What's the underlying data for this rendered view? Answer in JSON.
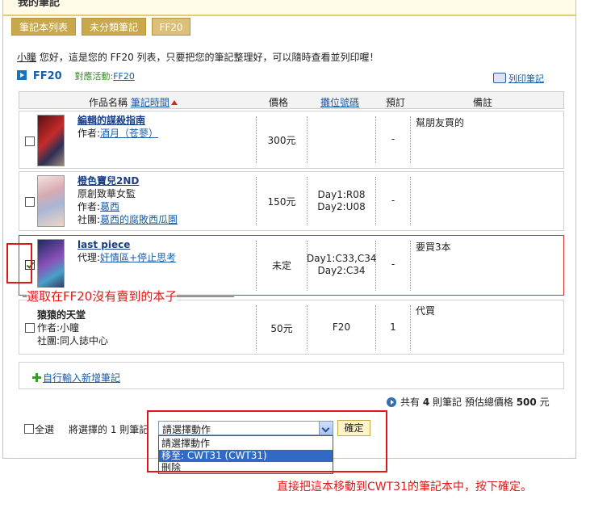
{
  "page": {
    "heading": "我的筆記"
  },
  "tabs": [
    {
      "label": "筆記本列表"
    },
    {
      "label": "未分類筆記"
    },
    {
      "label": "FF20"
    }
  ],
  "greeting": {
    "user": "小瞳",
    "text": " 您好，這是您的 FF20 列表，只要把您的筆記整理好，可以隨時查看並列印喔！"
  },
  "list": {
    "name": "FF20",
    "event_label": "對應活動:",
    "event_link": "FF20",
    "print_label": "列印筆記"
  },
  "table": {
    "headers": {
      "title": "作品名稱",
      "sort_time": "筆記時間",
      "price": "價格",
      "booth": "攤位號碼",
      "reserve": "預訂",
      "remark": "備註"
    },
    "rows": [
      {
        "title": "編輯的謀殺指南",
        "line2_label": "作者:",
        "line2_link": "酒月（苍蓼）",
        "line3_label": "",
        "line3_link": "",
        "price": "300元",
        "booth1": "",
        "booth2": "",
        "reserve": "-",
        "remark": "幫朋友買的",
        "checked": false
      },
      {
        "title": "橙色寶兒2ND",
        "line2_label": "原創致華女監",
        "line2_link": "",
        "line3_label": "作者:",
        "line3_link": "葛西",
        "line4_label": "社團:",
        "line4_link": "葛西的腐敗西瓜園",
        "price": "150元",
        "booth1": "Day1:R08",
        "booth2": "Day2:U08",
        "reserve": "-",
        "remark": "",
        "checked": false
      },
      {
        "title": "last piece",
        "line2_label": "代理:",
        "line2_link": "奸情區+停止思考",
        "price": "未定",
        "booth1": "Day1:C33,C34",
        "booth2": "Day2:C34",
        "reserve": "-",
        "remark": "要買3本",
        "checked": true
      },
      {
        "title": "猿猿的天堂",
        "line2_label": "作者:小瞳",
        "line3_label": "社團:同人誌中心",
        "price": "50元",
        "booth1": "F20",
        "booth2": "",
        "reserve": "1",
        "remark": "代買",
        "checked": false
      }
    ]
  },
  "add_note": {
    "label": "自行輸入新增筆記"
  },
  "summary": {
    "prefix": "共有",
    "count": "4",
    "mid": "則筆記 預估總價格",
    "total": "500",
    "suffix": "元"
  },
  "bulk": {
    "select_all": "全選",
    "selected_text": "將選擇的 1 則筆記",
    "select_value": "請選擇動作",
    "confirm": "確定",
    "options": [
      "請選擇動作",
      "移至: CWT31 (CWT31)",
      "刪除"
    ]
  },
  "annotations": {
    "select_note": "選取在FF20沒有賣到的本子",
    "move_note": "直接把這本移動到CWT31的筆記本中，按下確定。",
    "color": "#e01818"
  }
}
